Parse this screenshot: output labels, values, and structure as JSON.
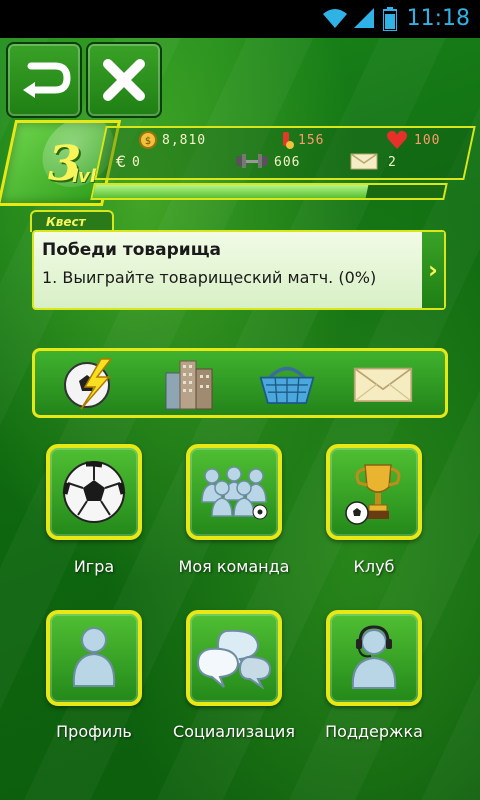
{
  "status_bar": {
    "time": "11:18",
    "icons": [
      "wifi-icon",
      "signal-icon",
      "battery-icon"
    ]
  },
  "top_buttons": {
    "back_icon": "back-arrow-icon",
    "close_icon": "close-icon"
  },
  "player": {
    "level": "3",
    "level_suffix": "lvl",
    "coins": "8,810",
    "power": "156",
    "health": "100",
    "euro": "0",
    "strength": "606",
    "messages": "2",
    "xp_progress": 0.78
  },
  "quest": {
    "tab_label": "Квест",
    "title": "Победи товарища",
    "description": "1. Выиграйте товарищеский матч. (0%)"
  },
  "quick_actions": [
    {
      "icon": "lightning-ball-icon"
    },
    {
      "icon": "buildings-icon"
    },
    {
      "icon": "shopping-basket-icon"
    },
    {
      "icon": "envelope-icon"
    }
  ],
  "menu": {
    "game": "Игра",
    "team": "Моя команда",
    "club": "Клуб",
    "profile": "Профиль",
    "social": "Социализация",
    "support": "Поддержка"
  },
  "colors": {
    "accent_yellow": "#e8e815",
    "field_green": "#1c8a1c",
    "status_blue": "#2fb3e6"
  }
}
